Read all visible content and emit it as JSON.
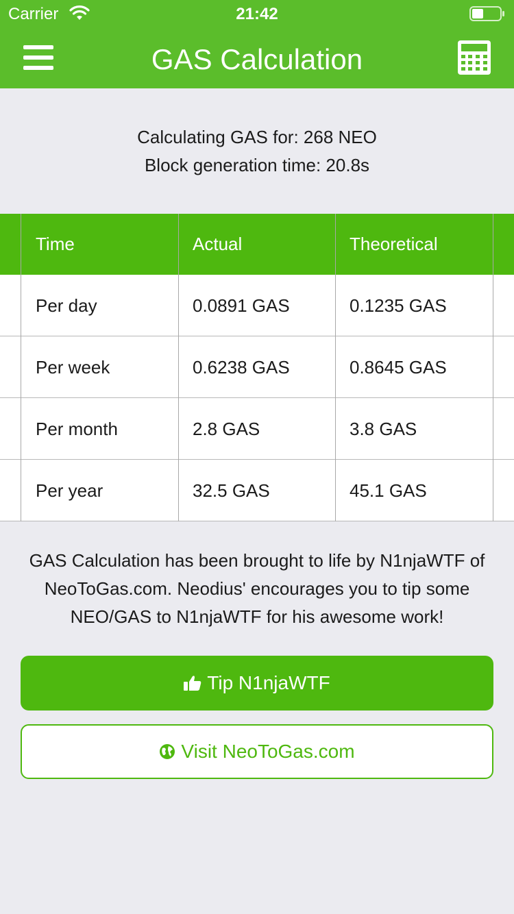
{
  "status_bar": {
    "carrier": "Carrier",
    "time": "21:42",
    "wifi_icon": "wifi-icon",
    "battery_icon": "battery-icon"
  },
  "header": {
    "title": "GAS Calculation",
    "menu_icon": "menu-icon",
    "calculator_icon": "calculator-icon",
    "background_color": "#5bbd2b"
  },
  "info": {
    "line1": "Calculating GAS for: 268 NEO",
    "line2": "Block generation time: 20.8s"
  },
  "table": {
    "headers": [
      "Time",
      "Actual",
      "Theoretical"
    ],
    "rows": [
      [
        "Per day",
        "0.0891 GAS",
        "0.1235 GAS"
      ],
      [
        "Per week",
        "0.6238 GAS",
        "0.8645 GAS"
      ],
      [
        "Per month",
        "2.8 GAS",
        "3.8 GAS"
      ],
      [
        "Per year",
        "32.5 GAS",
        "45.1 GAS"
      ]
    ]
  },
  "credit": {
    "line1": "GAS Calculation has been brought to life by N1njaWTF of",
    "line2": "NeoToGas.com. Neodius' encourages you to tip some",
    "line3": "NEO/GAS to N1njaWTF for his awesome work!"
  },
  "buttons": {
    "tip": {
      "label": "Tip N1njaWTF",
      "icon": "thumbs-up-icon"
    },
    "visit": {
      "label": "Visit NeoToGas.com",
      "icon": "globe-icon"
    }
  },
  "colors": {
    "accent": "#4eb80f",
    "background": "#ebebf0"
  }
}
